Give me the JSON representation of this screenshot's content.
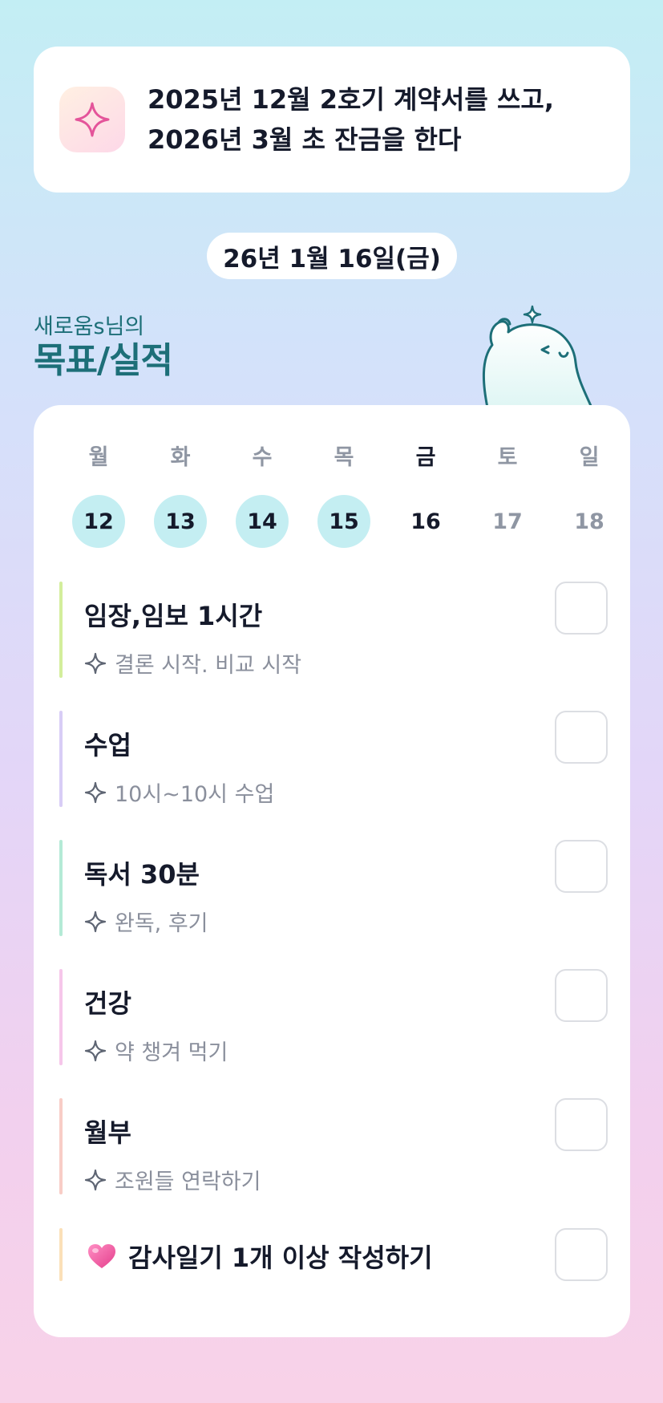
{
  "goal": {
    "icon": "sparkle-icon",
    "line1": "2025년 12월 2호기 계약서를 쓰고,",
    "line2": "2026년 3월 초 잔금을 한다"
  },
  "date_label": "26년 1월 16일(금)",
  "section": {
    "subtitle": "새로움s님의",
    "title": "목표/실적"
  },
  "week": [
    {
      "label": "월",
      "day": "12",
      "state": "done"
    },
    {
      "label": "화",
      "day": "13",
      "state": "done"
    },
    {
      "label": "수",
      "day": "14",
      "state": "done"
    },
    {
      "label": "목",
      "day": "15",
      "state": "done"
    },
    {
      "label": "금",
      "day": "16",
      "state": "today"
    },
    {
      "label": "토",
      "day": "17",
      "state": "future"
    },
    {
      "label": "일",
      "day": "18",
      "state": "future"
    }
  ],
  "tasks": [
    {
      "title": "임장,임보 1시간",
      "sub": "결론 시작. 비교 시작",
      "bar_color": "#d3ee9c",
      "checked": false
    },
    {
      "title": "수업",
      "sub": "10시~10시 수업",
      "bar_color": "#d8cdf6",
      "checked": false
    },
    {
      "title": "독서 30분",
      "sub": "완독, 후기",
      "bar_color": "#b4ead6",
      "checked": false
    },
    {
      "title": "건강",
      "sub": "약 챙겨 먹기",
      "bar_color": "#f6c6ea",
      "checked": false
    },
    {
      "title": "월부",
      "sub": "조원들 연락하기",
      "bar_color": "#f8cdc6",
      "checked": false
    },
    {
      "title": "감사일기 1개 이상 작성하기",
      "icon": "heart-icon",
      "bar_color": "#fbe0b8",
      "checked": false
    }
  ],
  "colors": {
    "accent_teal": "#1d6f78",
    "done_circle": "#c4eef2",
    "sparkle_pink": "#e4549a"
  }
}
